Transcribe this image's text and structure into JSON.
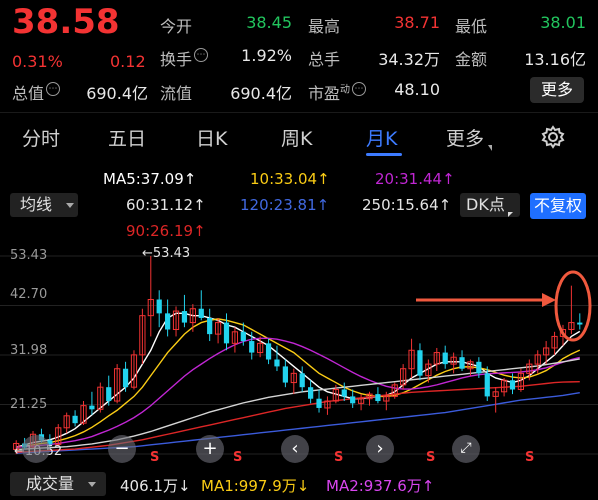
{
  "quote": {
    "price": "38.58",
    "change_pct": "0.31%",
    "change_abs": "0.12",
    "stats": {
      "open_label": "今开",
      "open": "38.45",
      "high_label": "最高",
      "high": "38.71",
      "low_label": "最低",
      "low": "38.01",
      "turnover_label": "换手",
      "turnover": "1.92%",
      "volume_label": "总手",
      "volume": "34.32万",
      "amount_label": "金额",
      "amount": "13.16亿",
      "mktcap_label": "总值",
      "mktcap": "690.4亿",
      "float_label": "流值",
      "float": "690.4亿",
      "pe_label": "市盈",
      "pe_sup": "动",
      "pe": "48.10"
    },
    "more_label": "更多"
  },
  "tabs": [
    "分时",
    "五日",
    "日K",
    "周K",
    "月K",
    "更多"
  ],
  "active_tab": "月K",
  "indicators": {
    "selector": "均线",
    "ma5": "MA5:37.09↑",
    "ma10": "10:33.04↑",
    "ma20": "20:31.44↑",
    "ma60": "60:31.12↑",
    "ma120": "120:23.81↑",
    "ma250": "250:15.64↑",
    "ma90": "90:26.19↑",
    "dk_label": "DK点",
    "adjust_label": "不复权"
  },
  "colors": {
    "up": "#f33333",
    "down": "#22d3ee",
    "ma5": "#ffffff",
    "ma10": "#facc15",
    "ma20": "#c026d3",
    "ma60": "#d4d4d4",
    "ma120": "#3b5bdb",
    "ma90": "#dc2626",
    "active_tab": "#3d7bff"
  },
  "chart": {
    "y_ticks": [
      "53.43",
      "42.70",
      "31.98",
      "21.25",
      "10.52"
    ],
    "max_label": "53.43",
    "min_label": "10.52",
    "s_marks": [
      "S",
      "S",
      "S",
      "S",
      "S"
    ]
  },
  "chart_data": {
    "type": "candlestick",
    "ylim": [
      10.52,
      53.43
    ],
    "max_marker": 53.43,
    "min_marker": 10.52,
    "candles": [
      {
        "o": 11.5,
        "h": 13.5,
        "l": 10.5,
        "c": 12.8
      },
      {
        "o": 12.8,
        "h": 14.0,
        "l": 11.5,
        "c": 11.9
      },
      {
        "o": 12.0,
        "h": 15.5,
        "l": 11.8,
        "c": 14.8
      },
      {
        "o": 14.8,
        "h": 16.0,
        "l": 13.0,
        "c": 13.5
      },
      {
        "o": 13.5,
        "h": 14.8,
        "l": 12.0,
        "c": 12.6
      },
      {
        "o": 12.6,
        "h": 17.0,
        "l": 12.4,
        "c": 16.2
      },
      {
        "o": 16.2,
        "h": 19.5,
        "l": 15.0,
        "c": 18.8
      },
      {
        "o": 18.8,
        "h": 20.0,
        "l": 16.5,
        "c": 17.2
      },
      {
        "o": 17.2,
        "h": 22.0,
        "l": 16.8,
        "c": 21.0
      },
      {
        "o": 21.0,
        "h": 24.0,
        "l": 19.0,
        "c": 20.2
      },
      {
        "o": 20.2,
        "h": 26.0,
        "l": 19.5,
        "c": 25.0
      },
      {
        "o": 25.0,
        "h": 27.5,
        "l": 21.0,
        "c": 22.0
      },
      {
        "o": 22.0,
        "h": 30.0,
        "l": 21.5,
        "c": 29.0
      },
      {
        "o": 29.0,
        "h": 30.5,
        "l": 24.0,
        "c": 25.0
      },
      {
        "o": 25.0,
        "h": 33.0,
        "l": 24.5,
        "c": 32.0
      },
      {
        "o": 32.0,
        "h": 42.0,
        "l": 30.0,
        "c": 40.5
      },
      {
        "o": 40.5,
        "h": 53.43,
        "l": 36.0,
        "c": 44.0
      },
      {
        "o": 44.0,
        "h": 46.0,
        "l": 38.0,
        "c": 41.0
      },
      {
        "o": 41.0,
        "h": 44.0,
        "l": 36.0,
        "c": 37.5
      },
      {
        "o": 37.5,
        "h": 42.5,
        "l": 36.0,
        "c": 41.5
      },
      {
        "o": 41.5,
        "h": 45.0,
        "l": 38.0,
        "c": 39.0
      },
      {
        "o": 39.0,
        "h": 43.0,
        "l": 37.0,
        "c": 42.0
      },
      {
        "o": 42.0,
        "h": 46.0,
        "l": 39.5,
        "c": 40.0
      },
      {
        "o": 40.0,
        "h": 42.0,
        "l": 35.0,
        "c": 36.5
      },
      {
        "o": 36.5,
        "h": 40.0,
        "l": 34.5,
        "c": 39.0
      },
      {
        "o": 39.0,
        "h": 41.0,
        "l": 33.0,
        "c": 34.5
      },
      {
        "o": 34.5,
        "h": 38.0,
        "l": 32.5,
        "c": 37.0
      },
      {
        "o": 37.0,
        "h": 39.0,
        "l": 34.0,
        "c": 35.0
      },
      {
        "o": 35.0,
        "h": 37.0,
        "l": 31.0,
        "c": 32.5
      },
      {
        "o": 32.5,
        "h": 36.0,
        "l": 31.5,
        "c": 34.5
      },
      {
        "o": 34.5,
        "h": 35.5,
        "l": 30.0,
        "c": 31.0
      },
      {
        "o": 31.0,
        "h": 34.0,
        "l": 28.5,
        "c": 29.5
      },
      {
        "o": 29.5,
        "h": 31.0,
        "l": 25.0,
        "c": 26.0
      },
      {
        "o": 26.0,
        "h": 29.0,
        "l": 23.5,
        "c": 28.0
      },
      {
        "o": 28.0,
        "h": 29.5,
        "l": 24.0,
        "c": 25.0
      },
      {
        "o": 25.0,
        "h": 26.5,
        "l": 21.5,
        "c": 22.5
      },
      {
        "o": 22.5,
        "h": 24.5,
        "l": 19.5,
        "c": 20.5
      },
      {
        "o": 20.5,
        "h": 23.0,
        "l": 19.0,
        "c": 22.0
      },
      {
        "o": 22.0,
        "h": 25.5,
        "l": 21.5,
        "c": 24.5
      },
      {
        "o": 24.5,
        "h": 26.0,
        "l": 22.0,
        "c": 23.0
      },
      {
        "o": 23.0,
        "h": 24.5,
        "l": 20.5,
        "c": 21.5
      },
      {
        "o": 21.5,
        "h": 23.5,
        "l": 20.0,
        "c": 22.5
      },
      {
        "o": 22.5,
        "h": 24.0,
        "l": 21.0,
        "c": 23.5
      },
      {
        "o": 23.5,
        "h": 25.0,
        "l": 21.5,
        "c": 22.0
      },
      {
        "o": 22.0,
        "h": 24.0,
        "l": 20.0,
        "c": 23.0
      },
      {
        "o": 23.0,
        "h": 26.0,
        "l": 22.5,
        "c": 25.5
      },
      {
        "o": 25.5,
        "h": 30.0,
        "l": 24.5,
        "c": 29.0
      },
      {
        "o": 29.0,
        "h": 35.5,
        "l": 27.0,
        "c": 33.0
      },
      {
        "o": 33.0,
        "h": 34.5,
        "l": 26.5,
        "c": 27.5
      },
      {
        "o": 27.5,
        "h": 31.0,
        "l": 26.0,
        "c": 30.0
      },
      {
        "o": 30.0,
        "h": 33.5,
        "l": 28.5,
        "c": 32.5
      },
      {
        "o": 32.5,
        "h": 34.0,
        "l": 29.0,
        "c": 30.0
      },
      {
        "o": 30.0,
        "h": 32.5,
        "l": 28.0,
        "c": 31.5
      },
      {
        "o": 31.5,
        "h": 33.0,
        "l": 28.5,
        "c": 29.0
      },
      {
        "o": 29.0,
        "h": 31.0,
        "l": 27.5,
        "c": 30.5
      },
      {
        "o": 30.5,
        "h": 31.5,
        "l": 27.0,
        "c": 28.0
      },
      {
        "o": 28.0,
        "h": 29.5,
        "l": 22.0,
        "c": 23.0
      },
      {
        "o": 23.0,
        "h": 25.0,
        "l": 19.5,
        "c": 24.0
      },
      {
        "o": 24.0,
        "h": 27.0,
        "l": 23.0,
        "c": 26.5
      },
      {
        "o": 26.5,
        "h": 28.0,
        "l": 23.5,
        "c": 24.5
      },
      {
        "o": 24.5,
        "h": 29.0,
        "l": 24.0,
        "c": 28.0
      },
      {
        "o": 28.0,
        "h": 31.0,
        "l": 26.5,
        "c": 30.0
      },
      {
        "o": 30.0,
        "h": 33.0,
        "l": 28.0,
        "c": 32.0
      },
      {
        "o": 32.0,
        "h": 35.0,
        "l": 30.0,
        "c": 33.5
      },
      {
        "o": 33.5,
        "h": 37.0,
        "l": 32.0,
        "c": 36.0
      },
      {
        "o": 36.0,
        "h": 38.5,
        "l": 34.0,
        "c": 37.5
      },
      {
        "o": 37.5,
        "h": 47.0,
        "l": 36.5,
        "c": 39.0
      },
      {
        "o": 39.0,
        "h": 41.0,
        "l": 37.5,
        "c": 38.58
      }
    ],
    "ma_lines": {
      "ma5": [
        12,
        12.5,
        13,
        13.3,
        13.6,
        14.2,
        15,
        16,
        17.5,
        19,
        20.5,
        22,
        23.5,
        25,
        27,
        30,
        33,
        37,
        40,
        41,
        41,
        40.5,
        40.5,
        40,
        39.5,
        38.5,
        38,
        37,
        36,
        35,
        34,
        32.5,
        31,
        29.5,
        28,
        26.5,
        25,
        24,
        23.5,
        23,
        22.5,
        22.5,
        22.8,
        23,
        23.2,
        24,
        25.5,
        27,
        28,
        29,
        30,
        30.5,
        30.5,
        30.5,
        30,
        29.5,
        28,
        27,
        26.5,
        26,
        26.5,
        27.5,
        29,
        30.5,
        32,
        34,
        36,
        37.09
      ],
      "ma10": [
        12,
        12.2,
        12.5,
        12.8,
        13,
        13.4,
        13.9,
        14.5,
        15.3,
        16.3,
        17.5,
        18.8,
        20,
        21.5,
        23,
        25,
        27.5,
        30,
        32.5,
        34.5,
        36.5,
        38,
        39,
        39.5,
        39.8,
        39.5,
        39,
        38.5,
        37.5,
        36.5,
        35.5,
        34.5,
        33.5,
        32.5,
        31,
        29.5,
        28,
        27,
        26,
        25,
        24.2,
        23.6,
        23.2,
        23,
        23,
        23.2,
        23.8,
        24.6,
        25.6,
        26.6,
        27.6,
        28.4,
        29,
        29.4,
        29.4,
        29.2,
        28.8,
        28.2,
        27.6,
        27.2,
        27,
        27.2,
        27.8,
        28.6,
        29.8,
        31.2,
        32.2,
        33.04
      ],
      "ma20": [
        12,
        12.1,
        12.2,
        12.4,
        12.6,
        12.8,
        13.1,
        13.4,
        13.8,
        14.3,
        15,
        15.7,
        16.5,
        17.4,
        18.4,
        19.6,
        21,
        22.6,
        24.2,
        25.8,
        27.4,
        28.8,
        30,
        31.2,
        32.3,
        33.3,
        34.2,
        34.9,
        35.4,
        35.6,
        35.6,
        35.4,
        35,
        34.5,
        33.8,
        33,
        32.1,
        31.2,
        30.2,
        29.2,
        28.2,
        27.3,
        26.5,
        25.8,
        25.2,
        24.8,
        24.6,
        24.6,
        24.8,
        25.1,
        25.5,
        26,
        26.5,
        27,
        27.4,
        27.7,
        27.9,
        28,
        28.1,
        28.2,
        28.3,
        28.5,
        28.8,
        29.2,
        29.8,
        30.4,
        31,
        31.44
      ],
      "ma60": [
        11.5,
        11.6,
        11.7,
        11.8,
        11.9,
        12,
        12.1,
        12.3,
        12.5,
        12.7,
        13,
        13.3,
        13.6,
        14,
        14.4,
        14.9,
        15.4,
        16,
        16.6,
        17.2,
        17.8,
        18.4,
        19,
        19.6,
        20.1,
        20.6,
        21.1,
        21.6,
        22,
        22.4,
        22.8,
        23.1,
        23.4,
        23.7,
        24,
        24.2,
        24.4,
        24.6,
        24.8,
        25,
        25.2,
        25.4,
        25.6,
        25.8,
        26,
        26.2,
        26.4,
        26.6,
        26.8,
        27,
        27.2,
        27.4,
        27.6,
        27.8,
        28,
        28.2,
        28.4,
        28.6,
        28.8,
        29,
        29.2,
        29.4,
        29.6,
        29.9,
        30.2,
        30.5,
        30.8,
        31.12
      ],
      "ma120": [
        10.7,
        10.8,
        10.9,
        11,
        11.1,
        11.2,
        11.3,
        11.4,
        11.5,
        11.6,
        11.7,
        11.8,
        11.9,
        12,
        12.1,
        12.3,
        12.5,
        12.7,
        12.9,
        13.1,
        13.3,
        13.5,
        13.7,
        13.9,
        14.1,
        14.3,
        14.5,
        14.7,
        14.9,
        15.1,
        15.3,
        15.5,
        15.7,
        15.9,
        16.1,
        16.3,
        16.5,
        16.7,
        16.9,
        17.1,
        17.3,
        17.5,
        17.7,
        17.9,
        18.1,
        18.3,
        18.5,
        18.7,
        18.9,
        19.1,
        19.3,
        19.5,
        19.8,
        20.1,
        20.4,
        20.7,
        21,
        21.3,
        21.6,
        21.9,
        22.2,
        22.4,
        22.6,
        22.8,
        23,
        23.2,
        23.5,
        23.81
      ],
      "ma90": [
        10.9,
        11,
        11.1,
        11.2,
        11.3,
        11.4,
        11.5,
        11.6,
        11.8,
        12,
        12.2,
        12.4,
        12.7,
        13,
        13.3,
        13.6,
        14,
        14.4,
        14.8,
        15.2,
        15.6,
        16,
        16.4,
        16.8,
        17.2,
        17.6,
        18,
        18.4,
        18.8,
        19.2,
        19.6,
        20,
        20.4,
        20.7,
        21,
        21.3,
        21.6,
        21.9,
        22.1,
        22.3,
        22.5,
        22.7,
        22.9,
        23.1,
        23.3,
        23.5,
        23.7,
        23.9,
        24,
        24.1,
        24.2,
        24.3,
        24.4,
        24.5,
        24.6,
        24.7,
        24.8,
        24.9,
        25,
        25.1,
        25.2,
        25.4,
        25.6,
        25.8,
        26,
        26.1,
        26.15,
        26.19
      ]
    }
  },
  "footer": {
    "selector": "成交量",
    "vol": "406.1万↓",
    "ma1": "MA1:997.9万↓",
    "ma2": "MA2:937.6万↑"
  }
}
